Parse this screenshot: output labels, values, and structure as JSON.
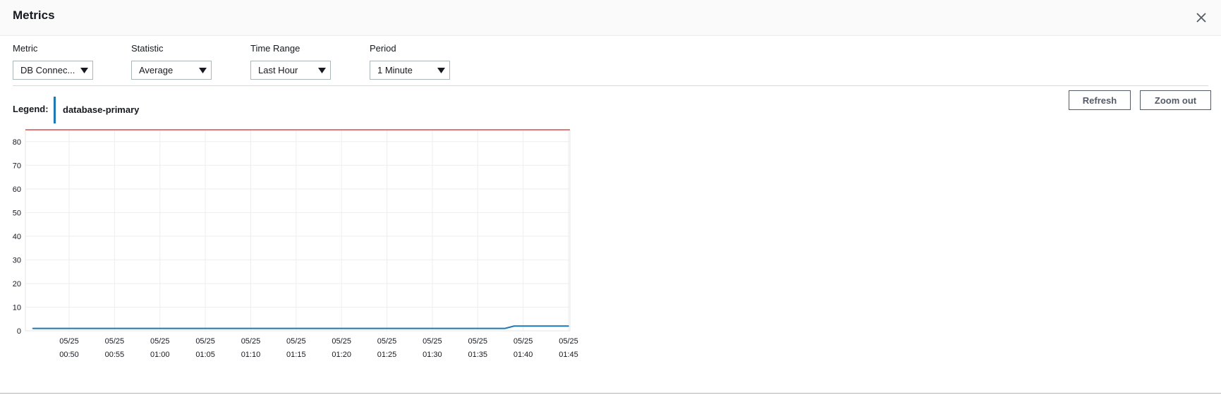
{
  "modal": {
    "title": "Metrics",
    "close_icon": "close-icon"
  },
  "controls": {
    "metric": {
      "label": "Metric",
      "value": "DB Connec..."
    },
    "statistic": {
      "label": "Statistic",
      "value": "Average"
    },
    "time_range": {
      "label": "Time Range",
      "value": "Last Hour"
    },
    "period": {
      "label": "Period",
      "value": "1 Minute"
    }
  },
  "legend": {
    "label": "Legend:",
    "items": [
      {
        "name": "database-primary",
        "color": "#1f77b4"
      }
    ]
  },
  "buttons": {
    "refresh": "Refresh",
    "zoom_out": "Zoom out"
  },
  "colors": {
    "series": "#1f77b4",
    "threshold": "#e07a7a",
    "grid": "#eeeeee"
  },
  "chart_data": {
    "type": "line",
    "y_ticks": [
      0,
      10,
      20,
      30,
      40,
      50,
      60,
      70,
      80
    ],
    "ylim": [
      0,
      85
    ],
    "x_ticks": [
      {
        "date": "05/25",
        "time": "00:50"
      },
      {
        "date": "05/25",
        "time": "00:55"
      },
      {
        "date": "05/25",
        "time": "01:00"
      },
      {
        "date": "05/25",
        "time": "01:05"
      },
      {
        "date": "05/25",
        "time": "01:10"
      },
      {
        "date": "05/25",
        "time": "01:15"
      },
      {
        "date": "05/25",
        "time": "01:20"
      },
      {
        "date": "05/25",
        "time": "01:25"
      },
      {
        "date": "05/25",
        "time": "01:30"
      },
      {
        "date": "05/25",
        "time": "01:35"
      },
      {
        "date": "05/25",
        "time": "01:40"
      },
      {
        "date": "05/25",
        "time": "01:45"
      }
    ],
    "threshold": 85,
    "grid": true,
    "legend_position": "top-left",
    "series": [
      {
        "name": "database-primary",
        "x": [
          "00:46",
          "01:38",
          "01:39",
          "01:45"
        ],
        "y": [
          1,
          1,
          2,
          2
        ]
      }
    ]
  }
}
